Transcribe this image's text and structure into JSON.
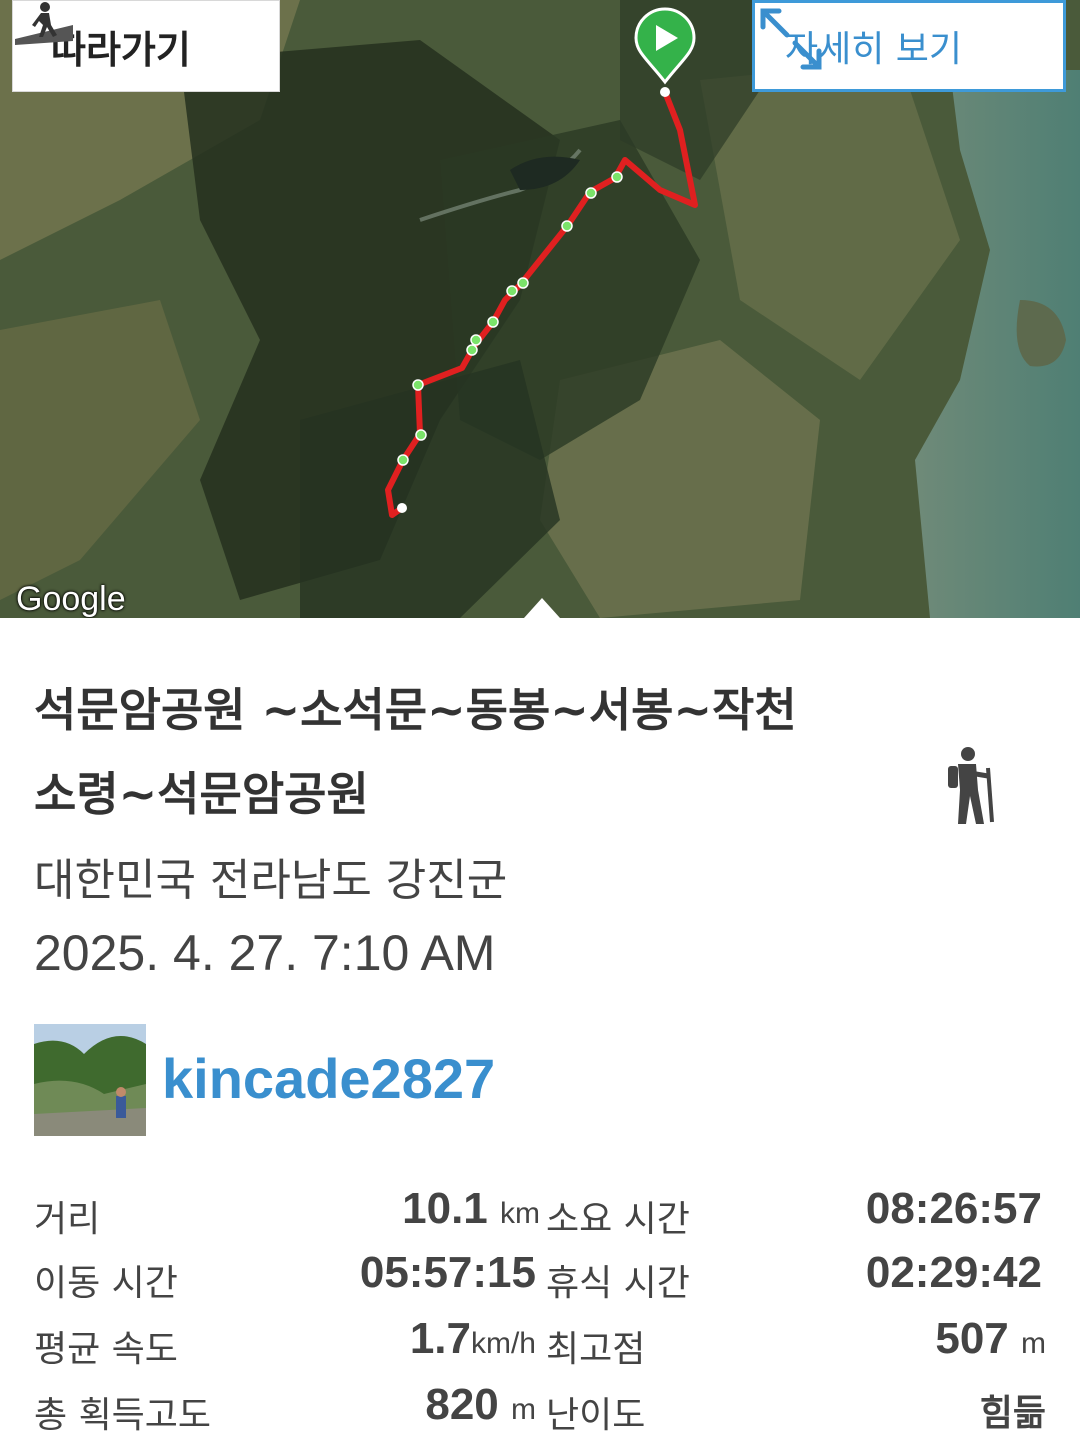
{
  "map": {
    "follow_label": "따라가기",
    "detail_label": "자세히 보기",
    "google_label": "Google",
    "route_color": "#e02020",
    "start_marker_color": "#34b24a"
  },
  "activity": {
    "title_line1": "석문암공원 ~소석문~동봉~서봉~작천",
    "title_line2": "소령~석문암공원",
    "activity_icon": "hiking-icon",
    "location": "대한민국 전라남도 강진군",
    "datetime": "2025. 4. 27. 7:10 AM"
  },
  "user": {
    "username": "kincade2827"
  },
  "stats": {
    "distance_label": "거리",
    "distance_value": "10.1",
    "distance_unit": "km",
    "total_time_label": "소요 시간",
    "total_time_value": "08:26:57",
    "moving_time_label": "이동 시간",
    "moving_time_value": "05:57:15",
    "rest_time_label": "휴식 시간",
    "rest_time_value": "02:29:42",
    "avg_speed_label": "평균 속도",
    "avg_speed_value": "1.7",
    "avg_speed_unit": "km/h",
    "max_alt_label": "최고점",
    "max_alt_value": "507",
    "max_alt_unit": "m",
    "elev_gain_label": "총 획득고도",
    "elev_gain_value": "820",
    "elev_gain_unit": "m",
    "difficulty_label": "난이도",
    "difficulty_value": "힘듦"
  }
}
